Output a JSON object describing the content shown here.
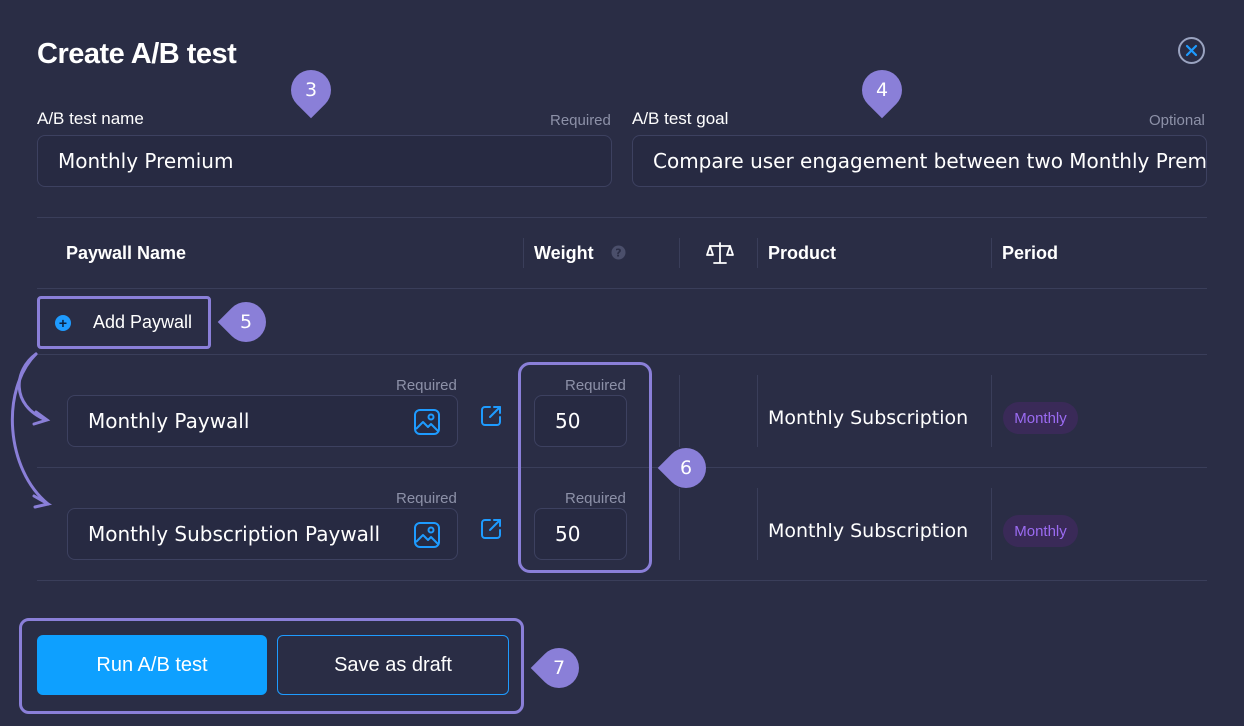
{
  "dialog": {
    "title": "Create A/B test",
    "close_label": "×"
  },
  "name_field": {
    "label": "A/B test name",
    "hint": "Required",
    "value": "Monthly Premium"
  },
  "goal_field": {
    "label": "A/B test goal",
    "hint": "Optional",
    "value": "Compare user engagement between two Monthly Premium paywalls"
  },
  "table": {
    "headers": {
      "paywall_name": "Paywall Name",
      "weight": "Weight",
      "product": "Product",
      "period": "Period"
    },
    "add_paywall_label": "Add Paywall",
    "required_label": "Required",
    "rows": [
      {
        "paywall": "Monthly Paywall",
        "weight": "50",
        "product": "Monthly Subscription",
        "period": "Monthly"
      },
      {
        "paywall": "Monthly Subscription Paywall",
        "weight": "50",
        "product": "Monthly Subscription",
        "period": "Monthly"
      }
    ]
  },
  "actions": {
    "run_label": "Run A/B test",
    "draft_label": "Save as draft"
  },
  "callouts": [
    "3",
    "4",
    "5",
    "6",
    "7"
  ],
  "colors": {
    "background": "#2a2d45",
    "accent": "#0ea0ff",
    "callout": "#8a7fd8",
    "period_text": "#9b6bf2"
  }
}
